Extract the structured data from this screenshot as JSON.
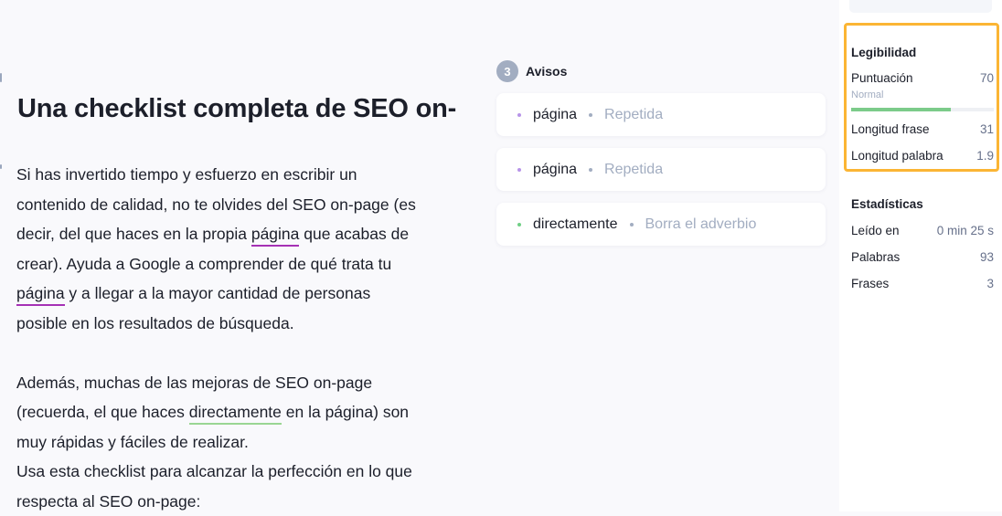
{
  "editor": {
    "title": "Una checklist completa de SEO on-",
    "lines": [
      [
        {
          "t": "Si has invertido tiempo y esfuerzo en escribir un"
        }
      ],
      [
        {
          "t": "contenido de calidad, no te olvides del SEO on-page (es"
        }
      ],
      [
        {
          "t": "decir, del que haces en la propia "
        },
        {
          "t": "página",
          "m": "purple"
        },
        {
          "t": " que acabas de"
        }
      ],
      [
        {
          "t": "crear). Ayuda a Google a comprender de qué trata tu"
        }
      ],
      [
        {
          "t": "página",
          "m": "purple"
        },
        {
          "t": " y a llegar a la mayor cantidad de personas"
        }
      ],
      [
        {
          "t": "posible en los resultados de búsqueda."
        }
      ],
      [],
      [
        {
          "t": "Además, muchas de las mejoras de SEO on-page"
        }
      ],
      [
        {
          "t": "(recuerda, el que haces "
        },
        {
          "t": "directamente",
          "m": "green"
        },
        {
          "t": " en la página) son"
        }
      ],
      [
        {
          "t": "muy rápidas y fáciles de realizar."
        }
      ],
      [
        {
          "t": "Usa esta checklist para alcanzar la perfección en lo que"
        }
      ],
      [
        {
          "t": "respecta al SEO on-page:"
        }
      ]
    ]
  },
  "warnings": {
    "count": "3",
    "title": "Avisos",
    "items": [
      {
        "word": "página",
        "hint": "Repetida",
        "color": "#b794e8"
      },
      {
        "word": "página",
        "hint": "Repetida",
        "color": "#b794e8"
      },
      {
        "word": "directamente",
        "hint": "Borra el adverbio",
        "color": "#6fcf85"
      }
    ]
  },
  "readability": {
    "title": "Legibilidad",
    "score_label": "Puntuación",
    "score": "70",
    "score_level": "Normal",
    "score_percent": 70,
    "sentence_label": "Longitud frase",
    "sentence": "31",
    "word_label": "Longitud palabra",
    "word": "1.9",
    "highlight_color": "#fbb534"
  },
  "stats": {
    "title": "Estadísticas",
    "read_label": "Leído en",
    "read": "0 min 25 s",
    "words_label": "Palabras",
    "words": "93",
    "sentences_label": "Frases",
    "sentences": "3"
  }
}
